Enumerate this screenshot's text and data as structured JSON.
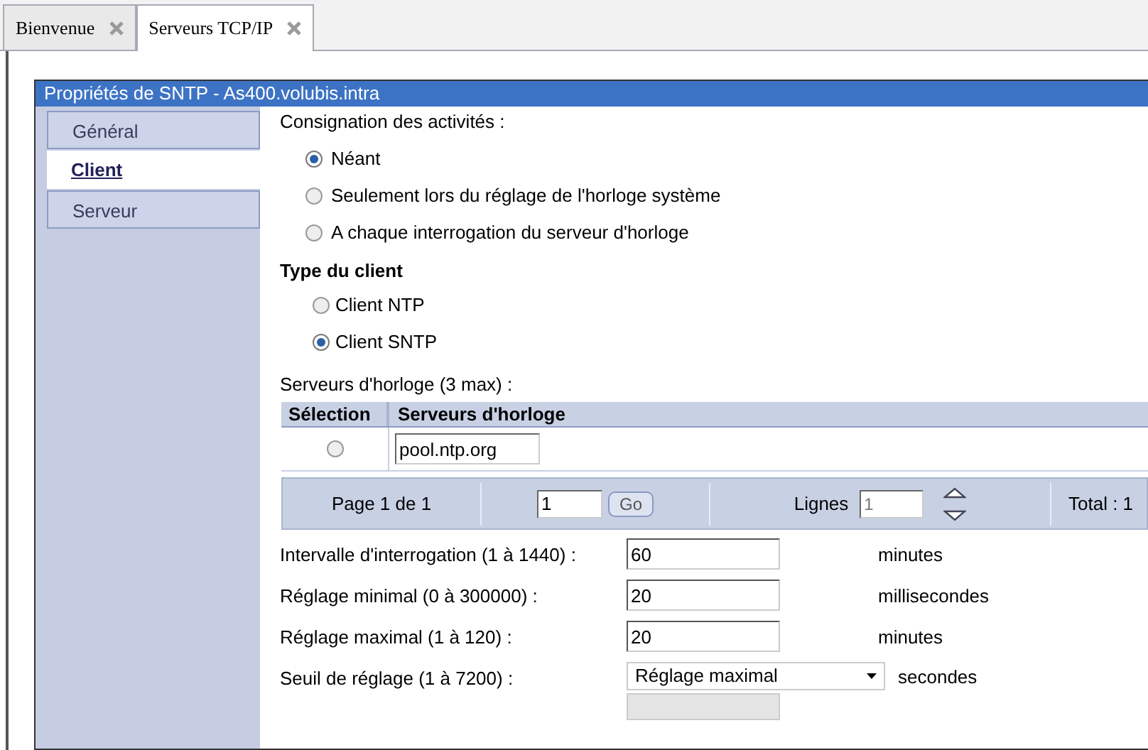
{
  "tabs": [
    {
      "label": "Bienvenue",
      "selected": false
    },
    {
      "label": "Serveurs TCP/IP",
      "selected": true
    }
  ],
  "panel": {
    "title": "Propriétés de SNTP - As400.volubis.intra"
  },
  "nav": [
    {
      "label": "Général",
      "selected": false
    },
    {
      "label": "Client",
      "selected": true
    },
    {
      "label": "Serveur",
      "selected": false
    }
  ],
  "logging": {
    "label": "Consignation des activités :",
    "options": [
      {
        "label": "Néant",
        "selected": true
      },
      {
        "label": "Seulement lors du réglage de l'horloge système",
        "selected": false
      },
      {
        "label": "A chaque interrogation du serveur d'horloge",
        "selected": false
      }
    ]
  },
  "client_type": {
    "title": "Type du client",
    "options": [
      {
        "label": "Client NTP",
        "selected": false
      },
      {
        "label": "Client SNTP",
        "selected": true
      }
    ]
  },
  "servers": {
    "label": "Serveurs d'horloge (3 max) :",
    "columns": [
      "Sélection",
      "Serveurs d'horloge"
    ],
    "rows": [
      {
        "selected": false,
        "value": "pool.ntp.org"
      }
    ],
    "pager": {
      "page_text": "Page 1 de 1",
      "page_input": "1",
      "go": "Go",
      "lines_label": "Lignes",
      "lines_value": "1",
      "total": "Total : 1"
    }
  },
  "fields": [
    {
      "kind": "input",
      "label": "Intervalle d'interrogation (1 à 1440) :",
      "value": "60",
      "unit": "minutes"
    },
    {
      "kind": "input",
      "label": "Réglage minimal (0 à 300000) :",
      "value": "20",
      "unit": "millisecondes"
    },
    {
      "kind": "input",
      "label": "Réglage maximal (1 à 120) :",
      "value": "20",
      "unit": "minutes"
    },
    {
      "kind": "select",
      "label": "Seuil de réglage (1 à 7200) :",
      "value": "Réglage maximal",
      "unit": "secondes"
    }
  ]
}
